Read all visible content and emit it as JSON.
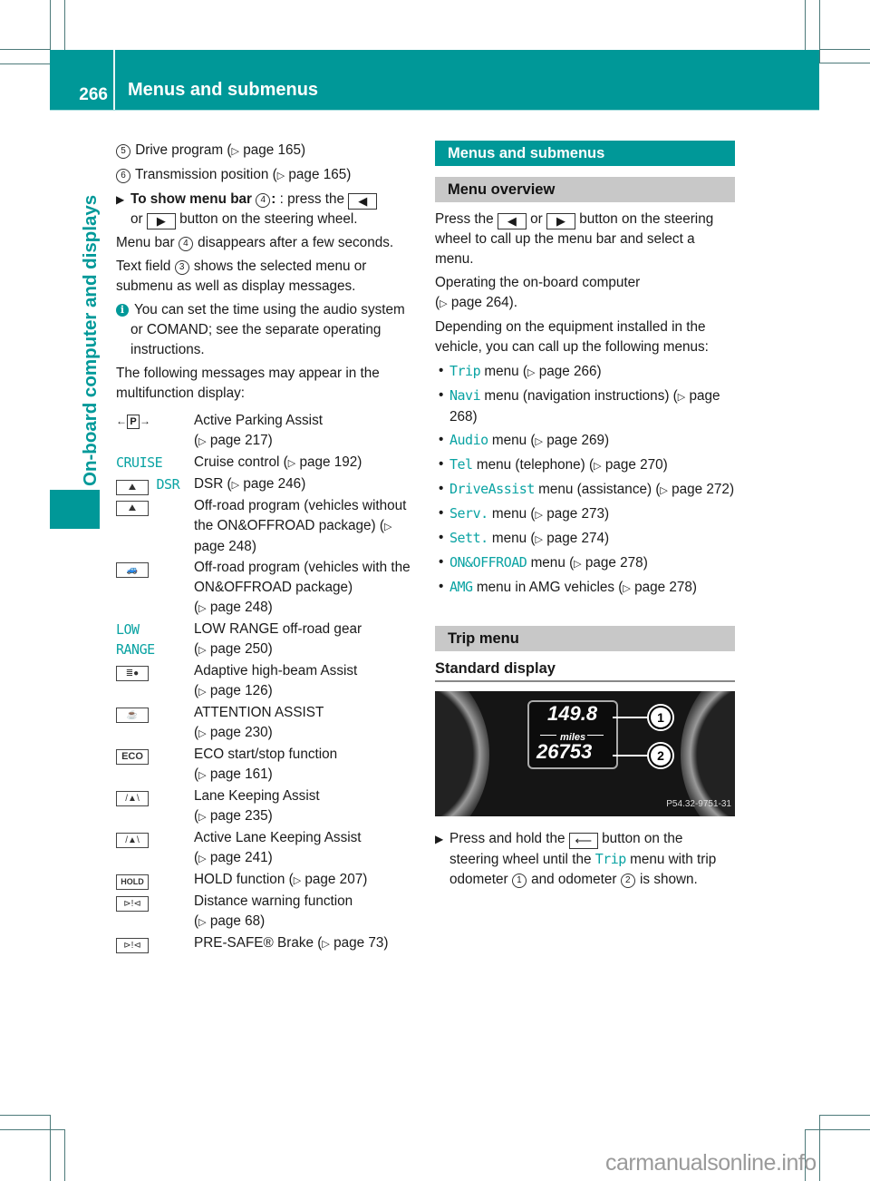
{
  "header": {
    "page_number": "266",
    "title": "Menus and submenus"
  },
  "sidebar": {
    "chapter_title": "On-board computer and displays"
  },
  "left_column": {
    "legend_items": [
      {
        "num": "5",
        "text": "Drive program (",
        "ref": "page 165",
        "close": ")"
      },
      {
        "num": "6",
        "text": "Transmission position (",
        "ref": "page 165",
        "close": ")"
      }
    ],
    "step1": {
      "bold": "To show menu bar",
      "num": "4",
      "after_colon": ": press the",
      "left_button": "◀",
      "or": "or",
      "right_button": "▶",
      "rest": "button on the steering wheel."
    },
    "para_menu_bar": {
      "pre": "Menu bar",
      "num": "4",
      "post": "disappears after a few seconds."
    },
    "para_text_field": {
      "pre": "Text field",
      "num": "3",
      "post": "shows the selected menu or submenu as well as display messages."
    },
    "info_note": "You can set the time using the audio system or COMAND; see the separate operating instructions.",
    "messages_intro": "The following messages may appear in the multifunction display:",
    "messages": [
      {
        "symbol": "←P→",
        "symbol_type": "parking-icon",
        "desc": "Active Parking Assist",
        "ref": "page 217"
      },
      {
        "symbol": "CRUISE",
        "symbol_type": "teal-text",
        "desc": "Cruise control",
        "ref": "page 192",
        "inline": true
      },
      {
        "symbol": "DSR",
        "symbol_type": "dsr-icon",
        "desc": "DSR",
        "ref": "page 246",
        "inline": true
      },
      {
        "symbol": "",
        "symbol_type": "offroad-icon",
        "desc": "Off-road program (vehicles without the ON&OFFROAD package)",
        "ref": "page 248",
        "inline": true
      },
      {
        "symbol": "",
        "symbol_type": "offroad-package-icon",
        "desc": "Off-road program (vehicles with the ON&OFFROAD package)",
        "ref": "page 248"
      },
      {
        "symbol": "LOW RANGE",
        "symbol_type": "teal-text",
        "desc": "LOW RANGE off-road gear",
        "ref": "page 250"
      },
      {
        "symbol": "",
        "symbol_type": "high-beam-icon",
        "desc": "Adaptive high-beam Assist",
        "ref": "page 126"
      },
      {
        "symbol": "",
        "symbol_type": "coffee-cup-icon",
        "desc": "ATTENTION ASSIST",
        "ref": "page 230"
      },
      {
        "symbol": "ECO",
        "symbol_type": "eco-icon",
        "desc": "ECO start/stop function",
        "ref": "page 161"
      },
      {
        "symbol": "",
        "symbol_type": "lane-keeping-icon",
        "desc": "Lane Keeping Assist",
        "ref": "page 235"
      },
      {
        "symbol": "",
        "symbol_type": "lane-keeping-icon",
        "desc": "Active Lane Keeping Assist",
        "ref": "page 241"
      },
      {
        "symbol": "HOLD",
        "symbol_type": "hold-icon",
        "desc": "HOLD function",
        "ref": "page 207",
        "inline": true
      },
      {
        "symbol": "",
        "symbol_type": "distance-warning-icon",
        "desc": "Distance warning function",
        "ref": "page 68"
      },
      {
        "symbol": "",
        "symbol_type": "distance-warning-icon",
        "desc": "PRE-SAFE® Brake",
        "ref": "page 73",
        "inline": true
      }
    ]
  },
  "right_column": {
    "section_title": "Menus and submenus",
    "menu_overview": {
      "title": "Menu overview",
      "p1_pre": "Press the",
      "left_button": "◀",
      "or": "or",
      "right_button": "▶",
      "p1_post": "button on the steering wheel to call up the menu bar and select a menu.",
      "p2_pre": "Operating the on-board computer",
      "p2_ref": "page 264",
      "p2_post": ").",
      "p3": "Depending on the equipment installed in the vehicle, you can call up the following menus:",
      "menus": [
        {
          "name": "Trip",
          "desc": "menu (",
          "ref": "page 266",
          "close": ")"
        },
        {
          "name": "Navi",
          "desc": "menu (navigation instructions) (",
          "ref": "page 268",
          "close": ")"
        },
        {
          "name": "Audio",
          "desc": "menu (",
          "ref": "page 269",
          "close": ")"
        },
        {
          "name": "Tel",
          "desc": "menu (telephone) (",
          "ref": "page 270",
          "close": ")"
        },
        {
          "name": "DriveAssist",
          "desc": "menu (assistance) (",
          "ref": "page 272",
          "close": ")"
        },
        {
          "name": "Serv.",
          "desc": "menu (",
          "ref": "page 273",
          "close": ")"
        },
        {
          "name": "Sett.",
          "desc": "menu (",
          "ref": "page 274",
          "close": ")"
        },
        {
          "name": "ON&OFFROAD",
          "desc": "menu (",
          "ref": "page 278",
          "close": ")"
        },
        {
          "name": "AMG",
          "desc": "menu in AMG vehicles (",
          "ref": "page 278",
          "close": ")"
        }
      ]
    },
    "trip_menu": {
      "title": "Trip menu",
      "subhead": "Standard display",
      "image": {
        "trip_value": "149.8",
        "unit": "miles",
        "odometer_value": "26753",
        "callout_1": "1",
        "callout_2": "2",
        "image_code": "P54.32-9751-31"
      },
      "step_pre": "Press and hold the",
      "back_button": "⟵",
      "step_mid": "button on the steering wheel until the",
      "menu_name": "Trip",
      "step_post1": "menu with trip odometer",
      "num1": "1",
      "step_post2": "and odometer",
      "num2": "2",
      "step_post3": "is shown."
    }
  },
  "watermark": "carmanualsonline.info",
  "colors": {
    "accent": "#009898",
    "grey_band": "#c8c8c8",
    "teal_text": "#0aa3a3"
  }
}
